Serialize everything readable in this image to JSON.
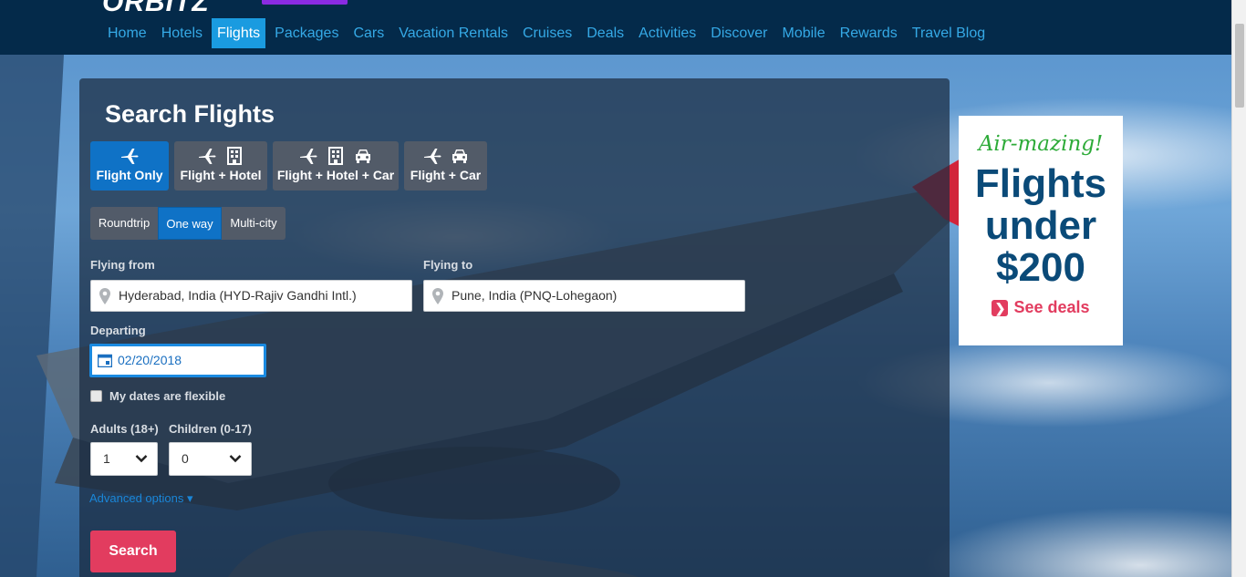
{
  "brand": {
    "logo": "ORBITZ"
  },
  "nav": {
    "items": [
      "Home",
      "Hotels",
      "Flights",
      "Packages",
      "Cars",
      "Vacation Rentals",
      "Cruises",
      "Deals",
      "Activities",
      "Discover",
      "Mobile",
      "Rewards",
      "Travel Blog"
    ],
    "active": "Flights"
  },
  "search": {
    "title": "Search Flights",
    "types": [
      {
        "label": "Flight Only",
        "icons": [
          "plane-icon"
        ],
        "active": true
      },
      {
        "label": "Flight + Hotel",
        "icons": [
          "plane-icon",
          "hotel-icon"
        ],
        "active": false
      },
      {
        "label": "Flight + Hotel + Car",
        "icons": [
          "plane-icon",
          "hotel-icon",
          "car-icon"
        ],
        "active": false
      },
      {
        "label": "Flight + Car",
        "icons": [
          "plane-icon",
          "car-icon"
        ],
        "active": false
      }
    ],
    "trip": {
      "roundtrip": "Roundtrip",
      "oneway": "One way",
      "multicity": "Multi-city",
      "selected": "One way"
    },
    "from_label": "Flying from",
    "from_value": "Hyderabad, India (HYD-Rajiv Gandhi Intl.)",
    "to_label": "Flying to",
    "to_value": "Pune, India (PNQ-Lohegaon)",
    "departing_label": "Departing",
    "departing_value": "02/20/2018",
    "flexible_label": "My dates are flexible",
    "adults_label": "Adults (18+)",
    "adults_value": "1",
    "children_label": "Children (0-17)",
    "children_value": "0",
    "advanced_label": "Advanced options ▾",
    "search_button": "Search"
  },
  "ad": {
    "tagline": "Air-mazing!",
    "line1": "Flights",
    "line2": "under",
    "line3": "$200",
    "cta": "See deals"
  },
  "colors": {
    "accent": "#0f72c6",
    "cta": "#e23c5f",
    "header": "#042a4a",
    "nav_link": "#35a9e6"
  }
}
